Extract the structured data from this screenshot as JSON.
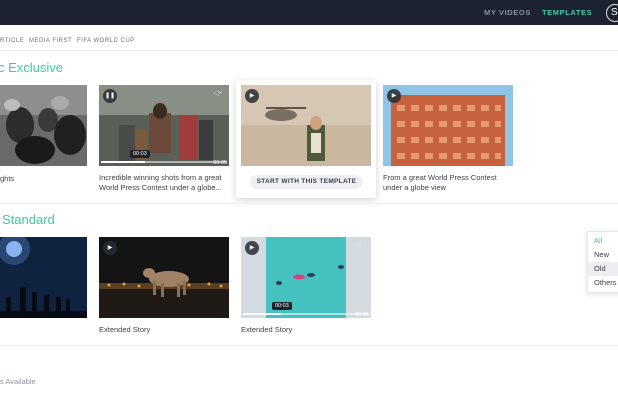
{
  "header": {
    "nav_my_videos": "MY VIDEOS",
    "nav_templates": "TEMPLATES",
    "avatar_letter": "S"
  },
  "filters": [
    "RTICLE",
    "MEDIA FIRST",
    "FIFA WORLD CUP"
  ],
  "sections": {
    "exclusive_title": "c Exclusive",
    "standard_title": "Standard"
  },
  "exclusive_cards": [
    {
      "caption": "ghts",
      "icon": "none"
    },
    {
      "caption": "Incredible winning shots from a great World Press Contest under a globe...",
      "icon": "pause-icon",
      "time_tip": "00:03",
      "time_end": "00:05",
      "progress": 0.35
    },
    {
      "caption": "",
      "icon": "play-icon",
      "button": "START WITH THIS TEMPLATE"
    },
    {
      "caption": "From a great World Press Contest under a globe view",
      "icon": "play-icon"
    }
  ],
  "standard_cards": [
    {
      "caption": "",
      "icon": "none"
    },
    {
      "caption": "Extended Story",
      "icon": "play-icon"
    },
    {
      "caption": "Extended Story",
      "icon": "play-icon",
      "time_tip": "00:03",
      "time_end": "00:05",
      "progress": 0.3
    }
  ],
  "dropdown": {
    "items": [
      "All",
      "New",
      "Old",
      "Others"
    ],
    "selected": "Old"
  },
  "footer": "s Available",
  "colors": {
    "accent": "#3ec9a7",
    "topbar": "#1c2230"
  }
}
